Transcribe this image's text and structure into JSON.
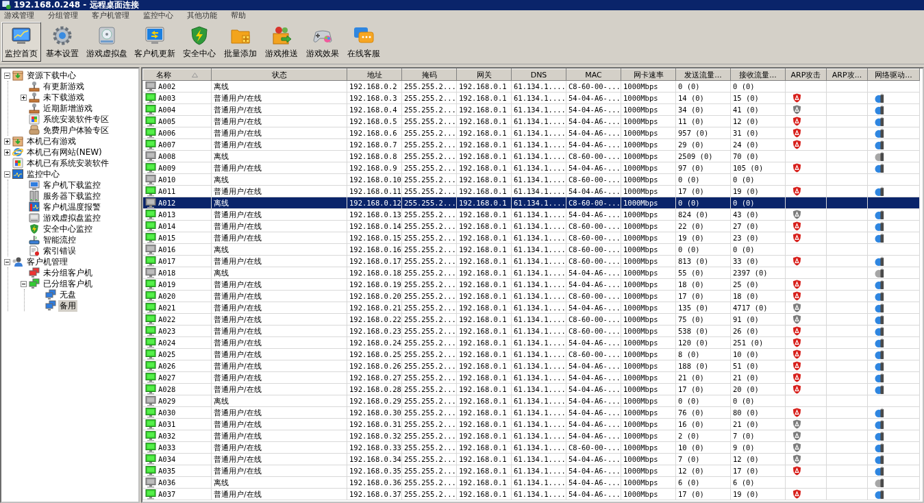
{
  "window": {
    "title": "192.168.0.248 - 远程桌面连接"
  },
  "menu": [
    "游戏管理",
    "分组管理",
    "客户机管理",
    "监控中心",
    "其他功能",
    "帮助"
  ],
  "toolbar": [
    {
      "label": "监控首页",
      "selected": true
    },
    {
      "label": "基本设置",
      "selected": false
    },
    {
      "label": "游戏虚拟盘",
      "selected": false
    },
    {
      "label": "客户机更新",
      "selected": false
    },
    {
      "label": "安全中心",
      "selected": false
    },
    {
      "label": "批量添加",
      "selected": false
    },
    {
      "label": "游戏推送",
      "selected": false
    },
    {
      "label": "游戏效果",
      "selected": false
    },
    {
      "label": "在线客服",
      "selected": false
    }
  ],
  "tree": [
    {
      "label": "资源下载中心",
      "expanded": true,
      "selected": false,
      "children": [
        {
          "label": "有更新游戏",
          "selected": false
        },
        {
          "label": "未下载游戏",
          "expanded": false,
          "selected": false
        },
        {
          "label": "近期新增游戏",
          "selected": false
        },
        {
          "label": "系统安装软件专区",
          "selected": false
        },
        {
          "label": "免费用户体验专区",
          "selected": false
        }
      ]
    },
    {
      "label": "本机已有游戏",
      "expanded": false,
      "selected": false
    },
    {
      "label": "本机已有网站(NEW)",
      "expanded": false,
      "selected": false
    },
    {
      "label": "本机已有系统安装软件",
      "selected": false
    },
    {
      "label": "监控中心",
      "expanded": true,
      "selected": false,
      "children": [
        {
          "label": "客户机下载监控",
          "selected": false
        },
        {
          "label": "服务器下载监控",
          "selected": false
        },
        {
          "label": "客户机温度报警",
          "selected": false
        },
        {
          "label": "游戏虚拟盘监控",
          "selected": false
        },
        {
          "label": "安全中心监控",
          "selected": false
        },
        {
          "label": "智能流控",
          "selected": false
        },
        {
          "label": "索引错误",
          "selected": false
        }
      ]
    },
    {
      "label": "客户机管理",
      "expanded": true,
      "selected": false,
      "children": [
        {
          "label": "未分组客户机",
          "selected": false
        },
        {
          "label": "已分组客户机",
          "expanded": true,
          "selected": false,
          "children": [
            {
              "label": "无盘",
              "selected": false
            },
            {
              "label": "备用",
              "selected": true
            }
          ]
        }
      ]
    }
  ],
  "table": {
    "columns": [
      {
        "label": "名称",
        "sorted": true
      },
      {
        "label": "状态",
        "sorted": false
      },
      {
        "label": "地址",
        "sorted": false
      },
      {
        "label": "掩码",
        "sorted": false
      },
      {
        "label": "网关",
        "sorted": false
      },
      {
        "label": "DNS",
        "sorted": false
      },
      {
        "label": "MAC",
        "sorted": false
      },
      {
        "label": "网卡速率",
        "sorted": false
      },
      {
        "label": "发送流量...",
        "sorted": false
      },
      {
        "label": "接收流量...",
        "sorted": false
      },
      {
        "label": "ARP攻击",
        "sorted": false
      },
      {
        "label": "ARP攻...",
        "sorted": false
      },
      {
        "label": "网络驱动...",
        "sorted": false
      }
    ],
    "rows": [
      {
        "name": "A002",
        "online": false,
        "status": "离线",
        "address": "192.168.0.2",
        "mask": "255.255.2...",
        "gateway": "192.168.0.1",
        "dns": "61.134.1....",
        "mac": "C8-60-00-...",
        "speed": "1000Mbps",
        "sent": "0 (0)",
        "received": "0 (0)",
        "arp_icon": false,
        "driver_icon": false,
        "selected": false
      },
      {
        "name": "A003",
        "online": true,
        "status": "普通用户/在线",
        "address": "192.168.0.3",
        "mask": "255.255.2...",
        "gateway": "192.168.0.1",
        "dns": "61.134.1....",
        "mac": "54-04-A6-...",
        "speed": "1000Mbps",
        "sent": "14 (0)",
        "received": "15 (0)",
        "arp_icon": true,
        "arp_active": true,
        "driver_icon": true,
        "driver_active": true,
        "selected": false
      },
      {
        "name": "A004",
        "online": true,
        "status": "普通用户/在线",
        "address": "192.168.0.4",
        "mask": "255.255.2...",
        "gateway": "192.168.0.1",
        "dns": "61.134.1....",
        "mac": "54-04-A6-...",
        "speed": "1000Mbps",
        "sent": "34 (0)",
        "received": "41 (0)",
        "arp_icon": true,
        "arp_active": false,
        "driver_icon": true,
        "driver_active": true,
        "selected": false
      },
      {
        "name": "A005",
        "online": true,
        "status": "普通用户/在线",
        "address": "192.168.0.5",
        "mask": "255.255.2...",
        "gateway": "192.168.0.1",
        "dns": "61.134.1....",
        "mac": "54-04-A6-...",
        "speed": "1000Mbps",
        "sent": "11 (0)",
        "received": "12 (0)",
        "arp_icon": true,
        "arp_active": true,
        "driver_icon": true,
        "driver_active": true,
        "selected": false
      },
      {
        "name": "A006",
        "online": true,
        "status": "普通用户/在线",
        "address": "192.168.0.6",
        "mask": "255.255.2...",
        "gateway": "192.168.0.1",
        "dns": "61.134.1....",
        "mac": "54-04-A6-...",
        "speed": "1000Mbps",
        "sent": "957 (0)",
        "received": "31 (0)",
        "arp_icon": true,
        "arp_active": true,
        "driver_icon": true,
        "driver_active": true,
        "selected": false
      },
      {
        "name": "A007",
        "online": true,
        "status": "普通用户/在线",
        "address": "192.168.0.7",
        "mask": "255.255.2...",
        "gateway": "192.168.0.1",
        "dns": "61.134.1....",
        "mac": "54-04-A6-...",
        "speed": "1000Mbps",
        "sent": "29 (0)",
        "received": "24 (0)",
        "arp_icon": true,
        "arp_active": true,
        "driver_icon": true,
        "driver_active": true,
        "selected": false
      },
      {
        "name": "A008",
        "online": false,
        "status": "离线",
        "address": "192.168.0.8",
        "mask": "255.255.2...",
        "gateway": "192.168.0.1",
        "dns": "61.134.1....",
        "mac": "C8-60-00-...",
        "speed": "1000Mbps",
        "sent": "2509 (0)",
        "received": "70 (0)",
        "arp_icon": false,
        "driver_icon": true,
        "driver_active": false,
        "selected": false
      },
      {
        "name": "A009",
        "online": true,
        "status": "普通用户/在线",
        "address": "192.168.0.9",
        "mask": "255.255.2...",
        "gateway": "192.168.0.1",
        "dns": "61.134.1....",
        "mac": "54-04-A6-...",
        "speed": "1000Mbps",
        "sent": "97 (0)",
        "received": "105 (0)",
        "arp_icon": true,
        "arp_active": true,
        "driver_icon": true,
        "driver_active": true,
        "selected": false
      },
      {
        "name": "A010",
        "online": false,
        "status": "离线",
        "address": "192.168.0.10",
        "mask": "255.255.2...",
        "gateway": "192.168.0.1",
        "dns": "61.134.1....",
        "mac": "C8-60-00-...",
        "speed": "1000Mbps",
        "sent": "0 (0)",
        "received": "0 (0)",
        "arp_icon": false,
        "driver_icon": false,
        "selected": false
      },
      {
        "name": "A011",
        "online": true,
        "status": "普通用户/在线",
        "address": "192.168.0.11",
        "mask": "255.255.2...",
        "gateway": "192.168.0.1",
        "dns": "61.134.1....",
        "mac": "54-04-A6-...",
        "speed": "1000Mbps",
        "sent": "17 (0)",
        "received": "19 (0)",
        "arp_icon": true,
        "arp_active": true,
        "driver_icon": true,
        "driver_active": true,
        "selected": false
      },
      {
        "name": "A012",
        "online": false,
        "status": "离线",
        "address": "192.168.0.12",
        "mask": "255.255.2...",
        "gateway": "192.168.0.1",
        "dns": "61.134.1....",
        "mac": "C8-60-00-...",
        "speed": "1000Mbps",
        "sent": "0 (0)",
        "received": "0 (0)",
        "arp_icon": false,
        "driver_icon": false,
        "selected": true
      },
      {
        "name": "A013",
        "online": true,
        "status": "普通用户/在线",
        "address": "192.168.0.13",
        "mask": "255.255.2...",
        "gateway": "192.168.0.1",
        "dns": "61.134.1....",
        "mac": "54-04-A6-...",
        "speed": "1000Mbps",
        "sent": "824 (0)",
        "received": "43 (0)",
        "arp_icon": true,
        "arp_active": false,
        "driver_icon": true,
        "driver_active": true,
        "selected": false
      },
      {
        "name": "A014",
        "online": true,
        "status": "普通用户/在线",
        "address": "192.168.0.14",
        "mask": "255.255.2...",
        "gateway": "192.168.0.1",
        "dns": "61.134.1....",
        "mac": "C8-60-00-...",
        "speed": "1000Mbps",
        "sent": "22 (0)",
        "received": "27 (0)",
        "arp_icon": true,
        "arp_active": true,
        "driver_icon": true,
        "driver_active": true,
        "selected": false
      },
      {
        "name": "A015",
        "online": true,
        "status": "普通用户/在线",
        "address": "192.168.0.15",
        "mask": "255.255.2...",
        "gateway": "192.168.0.1",
        "dns": "61.134.1....",
        "mac": "C8-60-00-...",
        "speed": "1000Mbps",
        "sent": "19 (0)",
        "received": "23 (0)",
        "arp_icon": true,
        "arp_active": true,
        "driver_icon": true,
        "driver_active": true,
        "selected": false
      },
      {
        "name": "A016",
        "online": false,
        "status": "离线",
        "address": "192.168.0.16",
        "mask": "255.255.2...",
        "gateway": "192.168.0.1",
        "dns": "61.134.1....",
        "mac": "C8-60-00-...",
        "speed": "1000Mbps",
        "sent": "0 (0)",
        "received": "0 (0)",
        "arp_icon": false,
        "driver_icon": false,
        "selected": false
      },
      {
        "name": "A017",
        "online": true,
        "status": "普通用户/在线",
        "address": "192.168.0.17",
        "mask": "255.255.2...",
        "gateway": "192.168.0.1",
        "dns": "61.134.1....",
        "mac": "C8-60-00-...",
        "speed": "1000Mbps",
        "sent": "813 (0)",
        "received": "33 (0)",
        "arp_icon": true,
        "arp_active": true,
        "driver_icon": true,
        "driver_active": true,
        "selected": false
      },
      {
        "name": "A018",
        "online": false,
        "status": "离线",
        "address": "192.168.0.18",
        "mask": "255.255.2...",
        "gateway": "192.168.0.1",
        "dns": "61.134.1....",
        "mac": "54-04-A6-...",
        "speed": "1000Mbps",
        "sent": "55 (0)",
        "received": "2397 (0)",
        "arp_icon": false,
        "driver_icon": true,
        "driver_active": false,
        "selected": false
      },
      {
        "name": "A019",
        "online": true,
        "status": "普通用户/在线",
        "address": "192.168.0.19",
        "mask": "255.255.2...",
        "gateway": "192.168.0.1",
        "dns": "61.134.1....",
        "mac": "54-04-A6-...",
        "speed": "1000Mbps",
        "sent": "18 (0)",
        "received": "25 (0)",
        "arp_icon": true,
        "arp_active": true,
        "driver_icon": true,
        "driver_active": true,
        "selected": false
      },
      {
        "name": "A020",
        "online": true,
        "status": "普通用户/在线",
        "address": "192.168.0.20",
        "mask": "255.255.2...",
        "gateway": "192.168.0.1",
        "dns": "61.134.1....",
        "mac": "C8-60-00-...",
        "speed": "1000Mbps",
        "sent": "17 (0)",
        "received": "18 (0)",
        "arp_icon": true,
        "arp_active": true,
        "driver_icon": true,
        "driver_active": true,
        "selected": false
      },
      {
        "name": "A021",
        "online": true,
        "status": "普通用户/在线",
        "address": "192.168.0.21",
        "mask": "255.255.2...",
        "gateway": "192.168.0.1",
        "dns": "61.134.1....",
        "mac": "54-04-A6-...",
        "speed": "1000Mbps",
        "sent": "135 (0)",
        "received": "4717 (0)",
        "arp_icon": true,
        "arp_active": false,
        "driver_icon": true,
        "driver_active": true,
        "selected": false
      },
      {
        "name": "A022",
        "online": true,
        "status": "普通用户/在线",
        "address": "192.168.0.22",
        "mask": "255.255.2...",
        "gateway": "192.168.0.1",
        "dns": "61.134.1....",
        "mac": "C8-60-00-...",
        "speed": "1000Mbps",
        "sent": "75 (0)",
        "received": "91 (0)",
        "arp_icon": true,
        "arp_active": false,
        "driver_icon": true,
        "driver_active": true,
        "selected": false
      },
      {
        "name": "A023",
        "online": true,
        "status": "普通用户/在线",
        "address": "192.168.0.23",
        "mask": "255.255.2...",
        "gateway": "192.168.0.1",
        "dns": "61.134.1....",
        "mac": "C8-60-00-...",
        "speed": "1000Mbps",
        "sent": "538 (0)",
        "received": "26 (0)",
        "arp_icon": true,
        "arp_active": true,
        "driver_icon": true,
        "driver_active": true,
        "selected": false
      },
      {
        "name": "A024",
        "online": true,
        "status": "普通用户/在线",
        "address": "192.168.0.24",
        "mask": "255.255.2...",
        "gateway": "192.168.0.1",
        "dns": "61.134.1....",
        "mac": "54-04-A6-...",
        "speed": "1000Mbps",
        "sent": "120 (0)",
        "received": "251 (0)",
        "arp_icon": true,
        "arp_active": true,
        "driver_icon": true,
        "driver_active": true,
        "selected": false
      },
      {
        "name": "A025",
        "online": true,
        "status": "普通用户/在线",
        "address": "192.168.0.25",
        "mask": "255.255.2...",
        "gateway": "192.168.0.1",
        "dns": "61.134.1....",
        "mac": "C8-60-00-...",
        "speed": "1000Mbps",
        "sent": "8 (0)",
        "received": "10 (0)",
        "arp_icon": true,
        "arp_active": true,
        "driver_icon": true,
        "driver_active": true,
        "selected": false
      },
      {
        "name": "A026",
        "online": true,
        "status": "普通用户/在线",
        "address": "192.168.0.26",
        "mask": "255.255.2...",
        "gateway": "192.168.0.1",
        "dns": "61.134.1....",
        "mac": "54-04-A6-...",
        "speed": "1000Mbps",
        "sent": "188 (0)",
        "received": "51 (0)",
        "arp_icon": true,
        "arp_active": true,
        "driver_icon": true,
        "driver_active": true,
        "selected": false
      },
      {
        "name": "A027",
        "online": true,
        "status": "普通用户/在线",
        "address": "192.168.0.27",
        "mask": "255.255.2...",
        "gateway": "192.168.0.1",
        "dns": "61.134.1....",
        "mac": "54-04-A6-...",
        "speed": "1000Mbps",
        "sent": "21 (0)",
        "received": "21 (0)",
        "arp_icon": true,
        "arp_active": true,
        "driver_icon": true,
        "driver_active": true,
        "selected": false
      },
      {
        "name": "A028",
        "online": true,
        "status": "普通用户/在线",
        "address": "192.168.0.28",
        "mask": "255.255.2...",
        "gateway": "192.168.0.1",
        "dns": "61.134.1....",
        "mac": "54-04-A6-...",
        "speed": "1000Mbps",
        "sent": "17 (0)",
        "received": "20 (0)",
        "arp_icon": true,
        "arp_active": true,
        "driver_icon": true,
        "driver_active": true,
        "selected": false
      },
      {
        "name": "A029",
        "online": false,
        "status": "离线",
        "address": "192.168.0.29",
        "mask": "255.255.2...",
        "gateway": "192.168.0.1",
        "dns": "61.134.1....",
        "mac": "54-04-A6-...",
        "speed": "1000Mbps",
        "sent": "0 (0)",
        "received": "0 (0)",
        "arp_icon": false,
        "driver_icon": false,
        "selected": false
      },
      {
        "name": "A030",
        "online": true,
        "status": "普通用户/在线",
        "address": "192.168.0.30",
        "mask": "255.255.2...",
        "gateway": "192.168.0.1",
        "dns": "61.134.1....",
        "mac": "54-04-A6-...",
        "speed": "1000Mbps",
        "sent": "76 (0)",
        "received": "80 (0)",
        "arp_icon": true,
        "arp_active": true,
        "driver_icon": true,
        "driver_active": true,
        "selected": false
      },
      {
        "name": "A031",
        "online": true,
        "status": "普通用户/在线",
        "address": "192.168.0.31",
        "mask": "255.255.2...",
        "gateway": "192.168.0.1",
        "dns": "61.134.1....",
        "mac": "54-04-A6-...",
        "speed": "1000Mbps",
        "sent": "16 (0)",
        "received": "21 (0)",
        "arp_icon": true,
        "arp_active": false,
        "driver_icon": true,
        "driver_active": true,
        "selected": false
      },
      {
        "name": "A032",
        "online": true,
        "status": "普通用户/在线",
        "address": "192.168.0.32",
        "mask": "255.255.2...",
        "gateway": "192.168.0.1",
        "dns": "61.134.1....",
        "mac": "54-04-A6-...",
        "speed": "1000Mbps",
        "sent": "2 (0)",
        "received": "7 (0)",
        "arp_icon": true,
        "arp_active": false,
        "driver_icon": true,
        "driver_active": true,
        "selected": false
      },
      {
        "name": "A033",
        "online": true,
        "status": "普通用户/在线",
        "address": "192.168.0.33",
        "mask": "255.255.2...",
        "gateway": "192.168.0.1",
        "dns": "61.134.1....",
        "mac": "C8-60-00-...",
        "speed": "1000Mbps",
        "sent": "10 (0)",
        "received": "9 (0)",
        "arp_icon": true,
        "arp_active": false,
        "driver_icon": true,
        "driver_active": true,
        "selected": false
      },
      {
        "name": "A034",
        "online": true,
        "status": "普通用户/在线",
        "address": "192.168.0.34",
        "mask": "255.255.2...",
        "gateway": "192.168.0.1",
        "dns": "61.134.1....",
        "mac": "54-04-A6-...",
        "speed": "1000Mbps",
        "sent": "7 (0)",
        "received": "12 (0)",
        "arp_icon": true,
        "arp_active": false,
        "driver_icon": true,
        "driver_active": true,
        "selected": false
      },
      {
        "name": "A035",
        "online": true,
        "status": "普通用户/在线",
        "address": "192.168.0.35",
        "mask": "255.255.2...",
        "gateway": "192.168.0.1",
        "dns": "61.134.1....",
        "mac": "54-04-A6-...",
        "speed": "1000Mbps",
        "sent": "12 (0)",
        "received": "17 (0)",
        "arp_icon": true,
        "arp_active": true,
        "driver_icon": true,
        "driver_active": true,
        "selected": false
      },
      {
        "name": "A036",
        "online": false,
        "status": "离线",
        "address": "192.168.0.36",
        "mask": "255.255.2...",
        "gateway": "192.168.0.1",
        "dns": "61.134.1....",
        "mac": "54-04-A6-...",
        "speed": "1000Mbps",
        "sent": "6 (0)",
        "received": "6 (0)",
        "arp_icon": false,
        "driver_icon": true,
        "driver_active": false,
        "selected": false
      },
      {
        "name": "A037",
        "online": true,
        "status": "普通用户/在线",
        "address": "192.168.0.37",
        "mask": "255.255.2...",
        "gateway": "192.168.0.1",
        "dns": "61.134.1....",
        "mac": "54-04-A6-...",
        "speed": "1000Mbps",
        "sent": "17 (0)",
        "received": "19 (0)",
        "arp_icon": true,
        "arp_active": true,
        "driver_icon": true,
        "driver_active": true,
        "selected": false
      }
    ]
  }
}
